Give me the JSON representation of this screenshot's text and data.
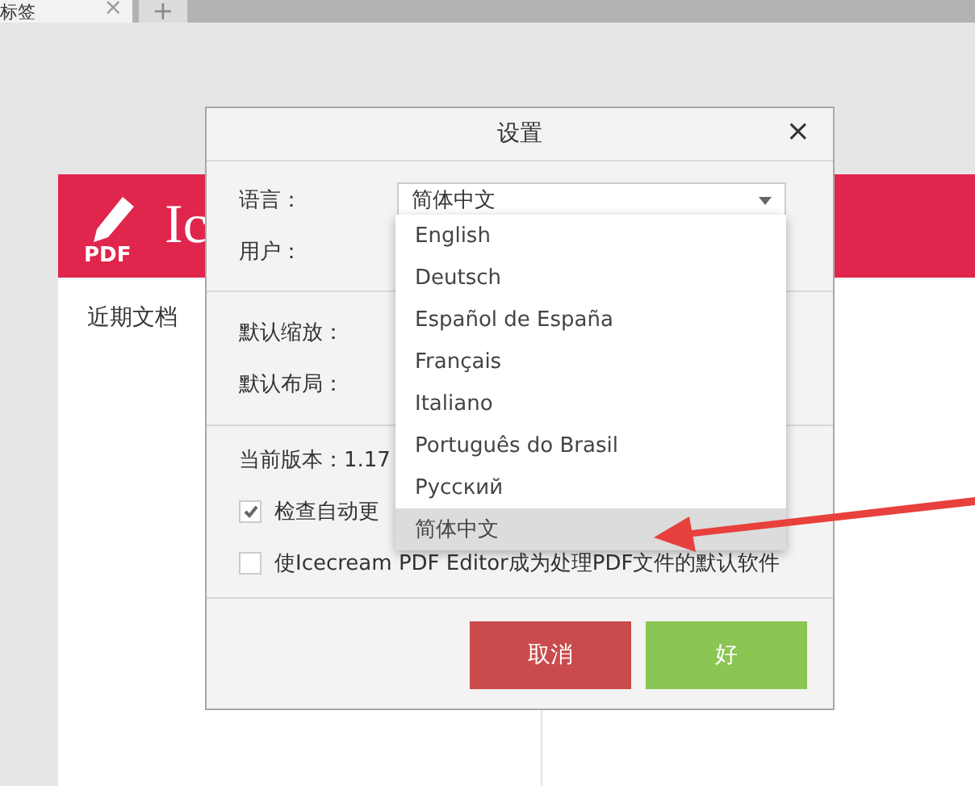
{
  "tabs": [
    {
      "label": "标签",
      "selected": true,
      "close": "×"
    }
  ],
  "new_tab": "+",
  "app_header": {
    "logo_text": "PDF",
    "title": "Ic"
  },
  "recent": {
    "title": "近期文档"
  },
  "dialog": {
    "title": "设置",
    "close": "×",
    "language": {
      "label": "语言：",
      "value": "简体中文",
      "options": [
        {
          "label": "English",
          "selected": false
        },
        {
          "label": "Deutsch",
          "selected": false
        },
        {
          "label": "Español de España",
          "selected": false
        },
        {
          "label": "Français",
          "selected": false
        },
        {
          "label": "Italiano",
          "selected": false
        },
        {
          "label": "Português do Brasil",
          "selected": false
        },
        {
          "label": "Русский",
          "selected": false
        },
        {
          "label": "简体中文",
          "selected": true
        }
      ]
    },
    "fields": [
      {
        "label": "用户："
      },
      {
        "label": "默认缩放："
      },
      {
        "label": "默认布局："
      }
    ],
    "version": "当前版本：1.17",
    "checkboxes": [
      {
        "label": "检查自动更",
        "checked": true
      },
      {
        "label": "使Icecream PDF Editor成为处理PDF文件的默认软件",
        "checked": false
      }
    ],
    "buttons": [
      {
        "label": "取消",
        "kind": "cancel"
      },
      {
        "label": "好",
        "kind": "ok"
      }
    ]
  }
}
